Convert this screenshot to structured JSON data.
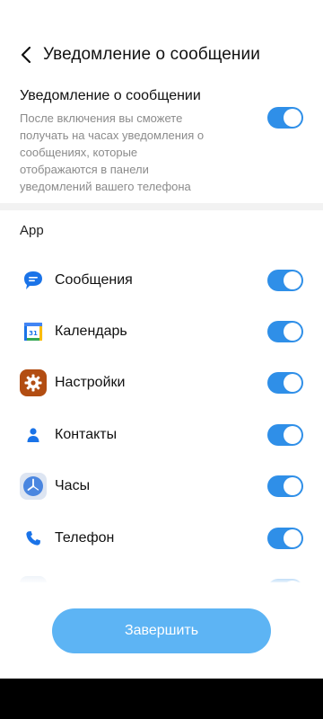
{
  "header": {
    "title": "Уведомление о сообщении"
  },
  "master": {
    "title": "Уведомление о сообщении",
    "description": "После включения вы сможете получать на часах уведомления о сообщениях, которые отображаются в панели уведомлений вашего телефона",
    "enabled": true
  },
  "section_label": "App",
  "apps": [
    {
      "name": "Сообщения",
      "icon": "messages-icon",
      "enabled": true
    },
    {
      "name": "Календарь",
      "icon": "calendar-icon",
      "enabled": true
    },
    {
      "name": "Настройки",
      "icon": "settings-gear-icon",
      "enabled": true
    },
    {
      "name": "Контакты",
      "icon": "contacts-icon",
      "enabled": true
    },
    {
      "name": "Часы",
      "icon": "clock-icon",
      "enabled": true
    },
    {
      "name": "Телефон",
      "icon": "phone-icon",
      "enabled": true
    },
    {
      "name": "",
      "icon": "app-icon",
      "enabled": true
    }
  ],
  "finish_button": "Завершить",
  "colors": {
    "toggle_on": "#2f8fe8",
    "button": "#5db4f4"
  }
}
